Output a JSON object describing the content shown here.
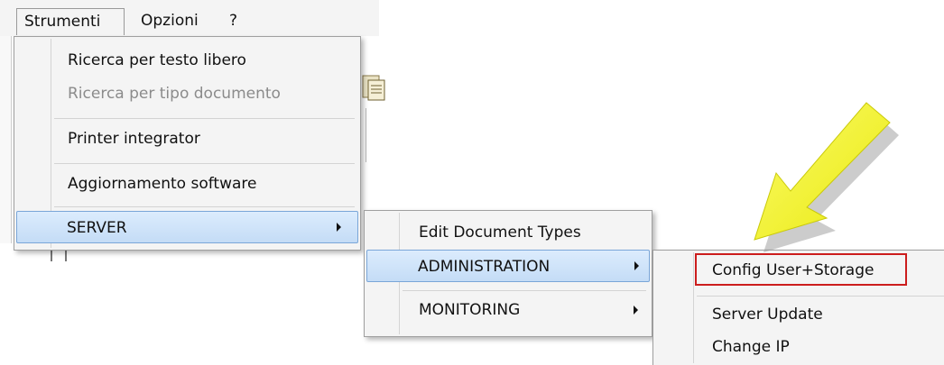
{
  "menubar": {
    "items": [
      "Strumenti",
      "Opzioni",
      "?"
    ]
  },
  "menu_strumenti": {
    "items": [
      {
        "label": "Ricerca per testo libero",
        "enabled": true
      },
      {
        "label": "Ricerca per tipo documento",
        "enabled": false
      },
      {
        "label": "Printer integrator",
        "enabled": true
      },
      {
        "label": "Aggiornamento software",
        "enabled": true
      },
      {
        "label": "SERVER",
        "enabled": true,
        "submenu": true,
        "highlighted": true
      }
    ]
  },
  "menu_server": {
    "items": [
      {
        "label": "Edit Document Types"
      },
      {
        "label": "ADMINISTRATION",
        "submenu": true,
        "highlighted": true
      },
      {
        "label": "MONITORING",
        "submenu": true
      }
    ]
  },
  "menu_administration": {
    "items": [
      {
        "label": "Config User+Storage",
        "outlined": true
      },
      {
        "label": "Server Update"
      },
      {
        "label": "Change IP"
      }
    ]
  },
  "colors": {
    "menu_bg": "#f4f4f4",
    "highlight_top": "#dcecfd",
    "highlight_bottom": "#c4dcf6",
    "highlight_border": "#7aa6d8",
    "disabled_text": "#8b8b8b",
    "annotation_red": "#cc1d1d",
    "arrow_yellow": "#f2f21a"
  },
  "icons": {
    "arrow_submenu": "chevron-right-icon",
    "annotation": "yellow-pointer-arrow-icon",
    "toolbar_document": "document-icon"
  }
}
